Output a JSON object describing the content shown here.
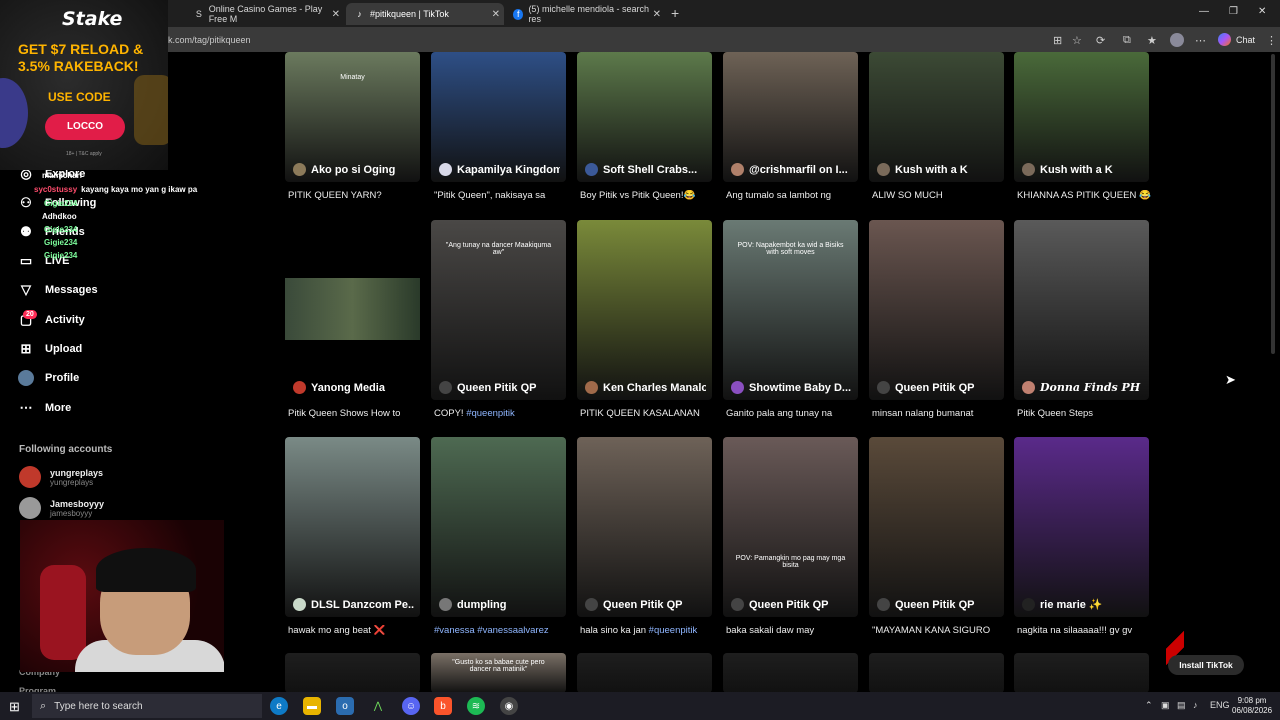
{
  "browser": {
    "tabs": [
      {
        "title": "Online Casino Games - Play Free M",
        "icon": "S"
      },
      {
        "title": "#pitikqueen | TikTok",
        "icon": "♪",
        "active": true
      },
      {
        "title": "(5) michelle mendiola - search res",
        "icon": "f"
      }
    ],
    "url": "k.com/tag/pitikqueen",
    "chat_label": "Chat"
  },
  "ad": {
    "logo": "Stake",
    "headline": "GET $7 RELOAD & 3.5% RAKEBACK!",
    "code_label": "USE CODE",
    "code": "LOCCO",
    "terms": "18+ | T&C apply"
  },
  "sidebar": {
    "nav": [
      {
        "label": "Explore",
        "icon": "compass-icon"
      },
      {
        "label": "Following",
        "icon": "following-icon"
      },
      {
        "label": "Friends",
        "icon": "friends-icon"
      },
      {
        "label": "LIVE",
        "icon": "live-icon"
      },
      {
        "label": "Messages",
        "icon": "messages-icon"
      },
      {
        "label": "Activity",
        "icon": "activity-icon"
      },
      {
        "label": "Upload",
        "icon": "upload-icon"
      },
      {
        "label": "Profile",
        "icon": "profile-icon"
      },
      {
        "label": "More",
        "icon": "more-icon"
      }
    ],
    "activity_badge": "20",
    "following_title": "Following accounts",
    "accounts": [
      {
        "name": "yungreplays",
        "handle": "yungreplays"
      },
      {
        "name": "Jamesboyyy",
        "handle": "jamesboyyy"
      }
    ],
    "company": "Company",
    "program": "Program"
  },
  "stream_chat": [
    {
      "user": "mamicharl",
      "text": "",
      "color": "#ffffff"
    },
    {
      "user": "syc0stussy",
      "text": "kayang kaya mo yan g ikaw pa",
      "color": "#ff4d6d"
    },
    {
      "user": "Gigie234",
      "text": "",
      "color": "#7CFC9B"
    },
    {
      "user": "Adhdkoo",
      "text": "",
      "color": "#ffffff"
    },
    {
      "user": "Gigie234",
      "text": "",
      "color": "#7CFC9B"
    },
    {
      "user": "Gigie234",
      "text": "",
      "color": "#7CFC9B"
    },
    {
      "user": "Gigie234",
      "text": "",
      "color": "#7CFC9B"
    }
  ],
  "videos": [
    {
      "author": "Ako po si Oging",
      "caption": "PITIK QUEEN YARN?",
      "thumb_text": "Minatay",
      "bg": "#6b7a5e",
      "av": "#8c7a5a"
    },
    {
      "author": "Kapamilya Kingdom",
      "caption": "\"Pitik Queen\", nakisaya sa",
      "thumb_text": "",
      "bg": "#2e4f86",
      "av": "#d8d8e8"
    },
    {
      "author": "Soft Shell Crabs...",
      "caption": "Boy Pitik vs Pitik Queen!😂",
      "thumb_text": "",
      "bg": "#5d7a4b",
      "av": "#3b5998"
    },
    {
      "author": "@crishmarfil on I...",
      "caption": "Ang tumalo sa lambot ng",
      "thumb_text": "",
      "bg": "#6e6256",
      "av": "#b0806a"
    },
    {
      "author": "Kush with a K",
      "caption": "ALIW SO MUCH",
      "thumb_text": "",
      "bg": "#3c4a35",
      "av": "#7a6a5a"
    },
    {
      "author": "Kush with a K",
      "caption": "KHIANNA AS PITIK QUEEN 😂",
      "thumb_text": "",
      "bg": "#4a6a3a",
      "av": "#7a6a5a"
    },
    {
      "author": "Yanong Media",
      "caption": "Pitik Queen Shows How to",
      "thumb_text": "",
      "bg": "#000000",
      "av": "#c0392b"
    },
    {
      "author": "Queen Pitik QP",
      "caption": "COPY! #queenpitik",
      "caption_plain": "COPY! ",
      "caption_tag": "#queenpitik",
      "thumb_text": "\"Ang tunay na dancer Maakiquma aw\"",
      "bg": "#4a4846",
      "av": "#444"
    },
    {
      "author": "Ken Charles Manalo",
      "caption": "PITIK QUEEN KASALANAN",
      "thumb_text": "",
      "bg": "#7a8a3a",
      "av": "#a06a4a"
    },
    {
      "author": "Showtime Baby D...",
      "caption": "Ganito pala ang tunay na",
      "thumb_text": "POV: Napakembot ka wid a Bisiks with soft moves",
      "bg": "#6a7a74",
      "av": "#8a4fc0"
    },
    {
      "author": "Queen Pitik QP",
      "caption": "minsan nalang bumanat",
      "thumb_text": "",
      "bg": "#6a5650",
      "av": "#444"
    },
    {
      "author": "Donna Finds PH",
      "caption": "Pitik Queen Steps",
      "thumb_text": "",
      "bg": "#5a5a5a",
      "av": "#c08070"
    },
    {
      "author": "DLSL Danzcom Pe...",
      "caption": "hawak mo ang beat ❌",
      "caption_plain": "hawak mo ang beat ",
      "caption_cross": "❌",
      "thumb_text": "",
      "bg": "#7a8a86",
      "av": "#c9d9c9"
    },
    {
      "author": "dumpling",
      "caption": "#vanessa #vanessaalvarez",
      "caption_tag_only": true,
      "thumb_text": "",
      "bg": "#4e6a52",
      "av": "#777"
    },
    {
      "author": "Queen Pitik QP",
      "caption": "hala sino ka jan #queenpitik",
      "caption_plain": "hala sino ka jan ",
      "caption_tag": "#queenpitik",
      "thumb_text": "",
      "bg": "#6e6258",
      "av": "#444"
    },
    {
      "author": "Queen Pitik QP",
      "caption": "baka sakali daw may",
      "thumb_text": "POV: Pamangkin mo pag may mga bisita",
      "bg": "#6a5a58",
      "av": "#444"
    },
    {
      "author": "Queen Pitik QP",
      "caption": "\"MAYAMAN KANA SIGURO",
      "thumb_text": "",
      "bg": "#5a4a3a",
      "av": "#444"
    },
    {
      "author": "rie marie ✨",
      "caption": "nagkita na silaaaaa!!! gv gv",
      "thumb_text": "",
      "bg": "#5a2a8a",
      "av": "#222"
    },
    {
      "author": "",
      "caption": "",
      "thumb_text": "",
      "bg": "#1e1e1e",
      "av": ""
    },
    {
      "author": "",
      "caption": "",
      "thumb_text": "\"Gusto ko sa babae cute pero dancer na matinik\"",
      "bg": "#7a7066",
      "av": ""
    },
    {
      "author": "",
      "caption": "",
      "thumb_text": "",
      "bg": "#1e1e1e",
      "av": ""
    },
    {
      "author": "",
      "caption": "",
      "thumb_text": "",
      "bg": "#1e1e1e",
      "av": ""
    },
    {
      "author": "",
      "caption": "",
      "thumb_text": "",
      "bg": "#1e1e1e",
      "av": ""
    },
    {
      "author": "",
      "caption": "",
      "thumb_text": "",
      "bg": "#1e1e1e",
      "av": ""
    }
  ],
  "install_button": "Install TikTok",
  "taskbar": {
    "search_placeholder": "Type here to search",
    "lang": "ENG",
    "time": "9:08 pm",
    "date": "06/08/2026"
  }
}
